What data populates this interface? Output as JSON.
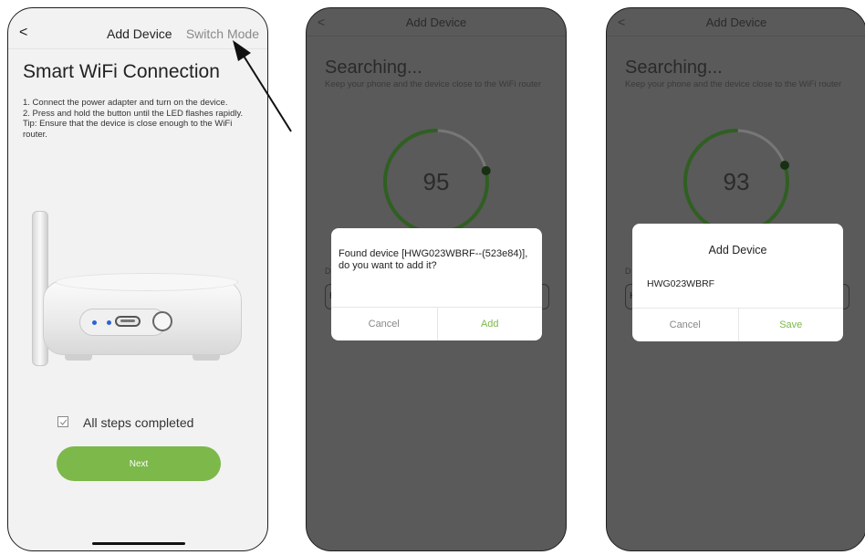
{
  "phone1": {
    "header": {
      "back_icon": "chevron-left-icon",
      "back_glyph": "<",
      "title": "Add Device",
      "switch_mode": "Switch Mode"
    },
    "heading": "Smart WiFi Connection",
    "instructions": [
      "1. Connect the power adapter and turn on the device.",
      "2. Press and hold the button until the LED flashes rapidly.",
      "Tip: Ensure that the device is close enough to the WiFi router."
    ],
    "checkbox": {
      "label": "All steps completed",
      "checked": true
    },
    "next_label": "Next",
    "accent_color": "#7cb84a"
  },
  "phone2": {
    "header": {
      "back_glyph": "<",
      "title": "Add Device"
    },
    "searching": "Searching...",
    "subtitle": "Keep your phone and the device close to the WiFi router",
    "countdown": 95,
    "ghost_label": "D",
    "ghost_input": "H",
    "dialog": {
      "message": "Found device [HWG023WBRF--(523e84)], do you want to add it?",
      "cancel": "Cancel",
      "confirm": "Add"
    }
  },
  "phone3": {
    "header": {
      "back_glyph": "<",
      "title": "Add Device"
    },
    "searching": "Searching...",
    "subtitle": "Keep your phone and the device close to the WiFi router",
    "countdown": 93,
    "ghost_label": "D",
    "ghost_input": "H",
    "dialog": {
      "title": "Add Device",
      "value": "HWG023WBRF",
      "cancel": "Cancel",
      "confirm": "Save"
    }
  }
}
